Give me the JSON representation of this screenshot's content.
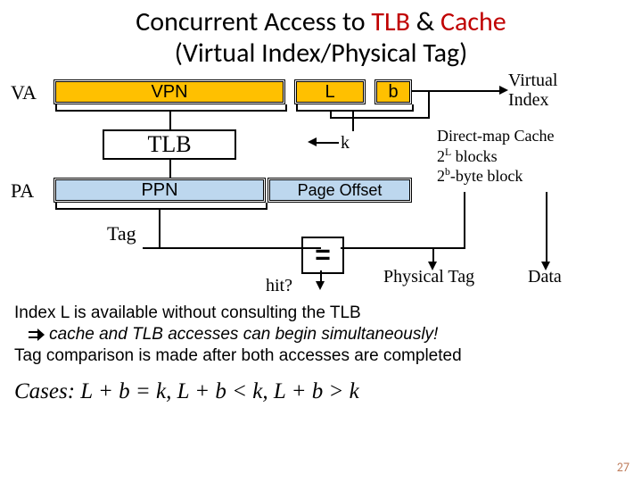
{
  "title_pre": "Concurrent Access to ",
  "title_tlb": "TLB",
  "title_amp": " & ",
  "title_cache": "Cache",
  "title_line2": "(Virtual Index/Physical Tag)",
  "va": "VA",
  "pa": "PA",
  "vpn": "VPN",
  "L": "L",
  "b": "b",
  "tlb": "TLB",
  "k": "k",
  "ppn": "PPN",
  "page_offset": "Page Offset",
  "tag": "Tag",
  "virtual_index": "Virtual\nIndex",
  "cache_desc_1": "Direct-map Cache",
  "cache_desc_2a": "2",
  "cache_desc_2b": "L",
  "cache_desc_2c": " blocks",
  "cache_desc_3a": "2",
  "cache_desc_3b": "b",
  "cache_desc_3c": "-byte block",
  "eq": "=",
  "hit": "hit?",
  "phys_tag": "Physical Tag",
  "data": "Data",
  "body1": "Index L is available without consulting the TLB",
  "body2": "cache and TLB accesses can begin simultaneously!",
  "body3": "Tag comparison is made after both accesses are completed",
  "cases": "Cases:  L + b = k,   L + b < k,   L + b > k",
  "page": "27"
}
